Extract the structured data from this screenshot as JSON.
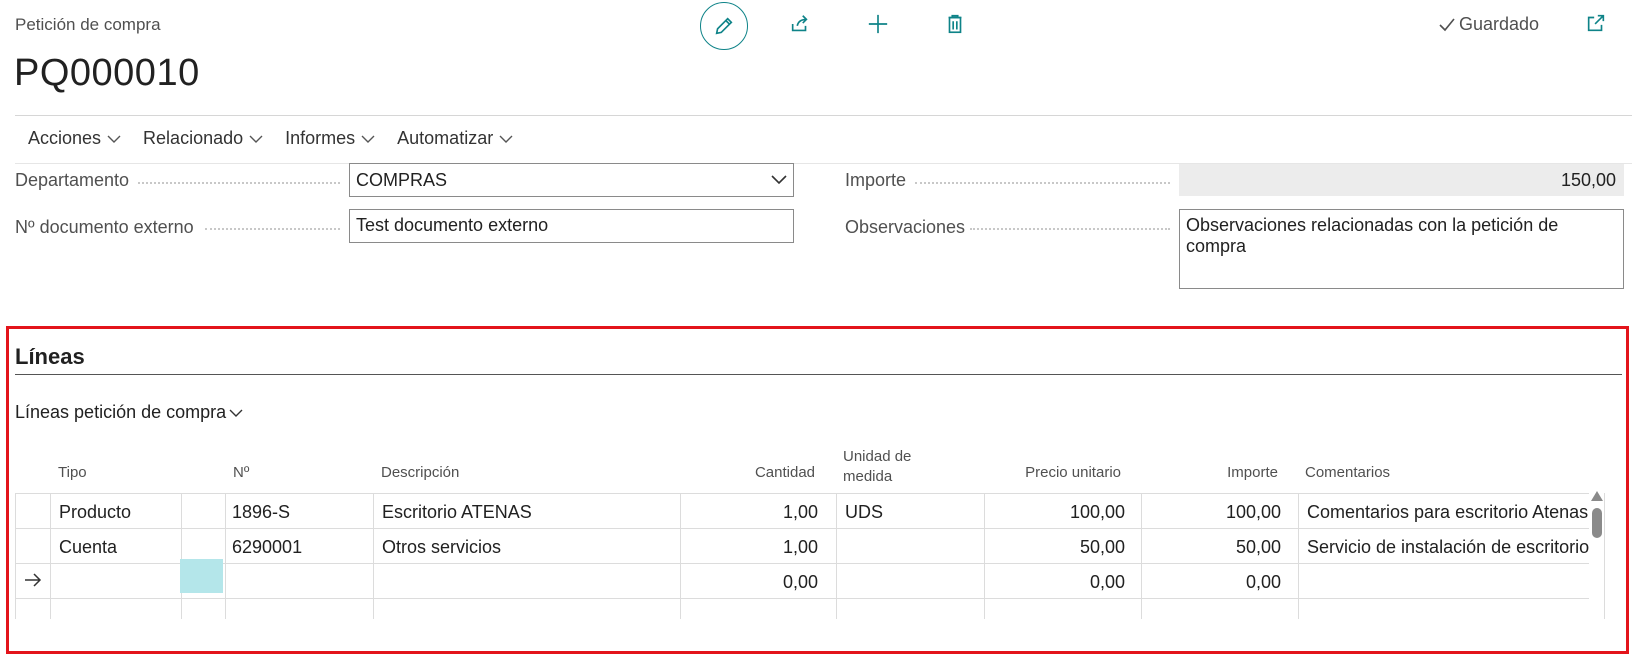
{
  "header": {
    "caption": "Petición de compra",
    "document_no": "PQ000010",
    "saved_status": "Guardado"
  },
  "menu": [
    {
      "label": "Acciones"
    },
    {
      "label": "Relacionado"
    },
    {
      "label": "Informes"
    },
    {
      "label": "Automatizar"
    }
  ],
  "fields": {
    "departamento_label": "Departamento",
    "departamento_value": "COMPRAS",
    "doc_externo_label": "Nº documento externo",
    "doc_externo_value": "Test documento externo",
    "importe_label": "Importe",
    "importe_value": "150,00",
    "observaciones_label": "Observaciones",
    "observaciones_value": "Observaciones relacionadas con la petición de compra"
  },
  "lines": {
    "title": "Líneas",
    "subpart_label": "Líneas petición de compra",
    "columns": {
      "tipo": "Tipo",
      "no": "Nº",
      "descripcion": "Descripción",
      "cantidad": "Cantidad",
      "unidad_1": "Unidad de",
      "unidad_2": "medida",
      "precio": "Precio unitario",
      "importe": "Importe",
      "comentarios": "Comentarios"
    },
    "rows": [
      {
        "tipo": "Producto",
        "no": "1896-S",
        "descripcion": "Escritorio ATENAS",
        "cantidad": "1,00",
        "unidad": "UDS",
        "precio": "100,00",
        "importe": "100,00",
        "comentarios": "Comentarios para escritorio Atenas"
      },
      {
        "tipo": "Cuenta",
        "no": "6290001",
        "descripcion": "Otros servicios",
        "cantidad": "1,00",
        "unidad": "",
        "precio": "50,00",
        "importe": "50,00",
        "comentarios": "Servicio de instalación de escritorio"
      },
      {
        "tipo": "",
        "no": "",
        "descripcion": "",
        "cantidad": "0,00",
        "unidad": "",
        "precio": "0,00",
        "importe": "0,00",
        "comentarios": ""
      }
    ]
  },
  "colors": {
    "accent": "#0e8388",
    "highlight_frame": "#e3141b",
    "selected_cell": "#b4e6ea"
  }
}
